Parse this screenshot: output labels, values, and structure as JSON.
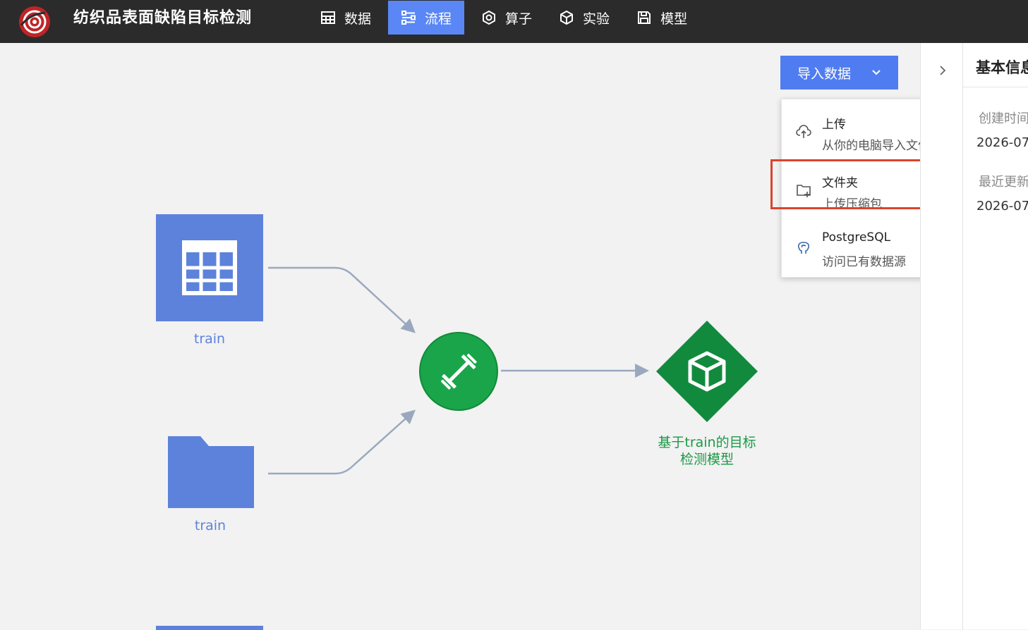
{
  "app": {
    "title": "纺织品表面缺陷目标检测"
  },
  "nav": {
    "items": [
      {
        "label": "数据",
        "icon": "table-icon",
        "active": false
      },
      {
        "label": "流程",
        "icon": "flow-icon",
        "active": true
      },
      {
        "label": "算子",
        "icon": "hexagon-icon",
        "active": false
      },
      {
        "label": "实验",
        "icon": "cube-icon",
        "active": false
      },
      {
        "label": "模型",
        "icon": "save-icon",
        "active": false
      }
    ]
  },
  "toolbar": {
    "import_label": "导入数据"
  },
  "import_menu": {
    "items": [
      {
        "title": "上传",
        "subtitle": "从你的电脑导入文件",
        "icon": "cloud-upload-icon"
      },
      {
        "title": "文件夹",
        "subtitle": "上传压缩包",
        "icon": "folder-add-icon"
      },
      {
        "title": "PostgreSQL",
        "subtitle": "访问已有数据源",
        "icon": "postgresql-icon"
      }
    ]
  },
  "flow": {
    "table_node_label": "train",
    "folder_node_label": "train",
    "model_node_label_line1": "基于train的目标",
    "model_node_label_line2": "检测模型"
  },
  "right_panel": {
    "title": "基本信息",
    "created_label": "创建时间",
    "created_value": "2026-07",
    "updated_label": "最近更新",
    "updated_value": "2026-07"
  },
  "colors": {
    "topbar": "#2b2b2b",
    "accent": "#4f7cf1",
    "node_blue": "#5d82dc",
    "node_green": "#1aa54a",
    "model_green": "#128a3e",
    "highlight": "#d9442c"
  }
}
